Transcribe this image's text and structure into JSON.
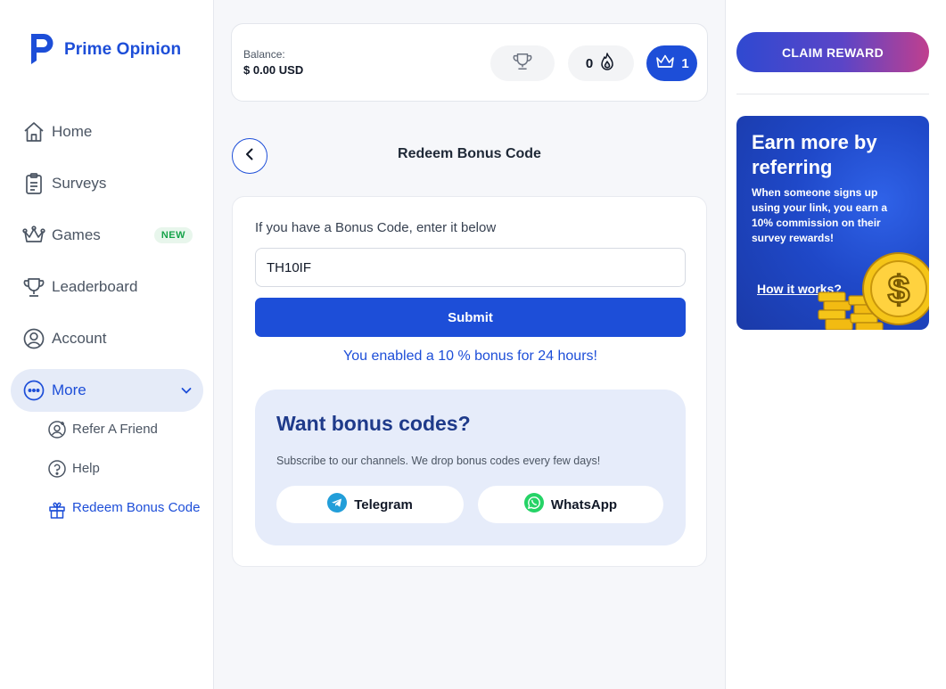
{
  "app": {
    "name": "Prime Opinion"
  },
  "sidebar": {
    "items": [
      {
        "label": "Home",
        "icon": "home-icon"
      },
      {
        "label": "Surveys",
        "icon": "clipboard-icon"
      },
      {
        "label": "Games",
        "icon": "crown-icon",
        "badge": "NEW"
      },
      {
        "label": "Leaderboard",
        "icon": "trophy-icon"
      },
      {
        "label": "Account",
        "icon": "user-circle-icon"
      },
      {
        "label": "More",
        "icon": "more-dots-icon",
        "active": true
      }
    ],
    "subitems": [
      {
        "label": "Refer A Friend",
        "icon": "add-user-icon"
      },
      {
        "label": "Help",
        "icon": "help-icon"
      },
      {
        "label": "Redeem Bonus Code",
        "icon": "gift-icon",
        "active": true
      }
    ]
  },
  "header": {
    "balance_label": "Balance:",
    "balance_value": "$ 0.00 USD",
    "streak_count": "0",
    "level": "1"
  },
  "page": {
    "title": "Redeem Bonus Code",
    "prompt": "If you have a Bonus Code, enter it below",
    "code_value": "TH10IF",
    "submit_label": "Submit",
    "success_message": "You enabled a 10 % bonus for 24 hours!"
  },
  "promo": {
    "title": "Want bonus codes?",
    "description": "Subscribe to our channels. We drop bonus codes every few days!",
    "telegram_label": "Telegram",
    "whatsapp_label": "WhatsApp"
  },
  "right_panel": {
    "claim_label": "CLAIM REWARD",
    "refer_title": "Earn more by referring",
    "refer_desc": "When someone signs up using your link, you earn a 10% commission on their survey rewards!",
    "refer_link": "How it works?"
  },
  "colors": {
    "brand": "#1d4ed8",
    "new_badge": "#16a34a",
    "telegram": "#229ED9",
    "whatsapp": "#25D366",
    "coin": "#f5c518"
  }
}
